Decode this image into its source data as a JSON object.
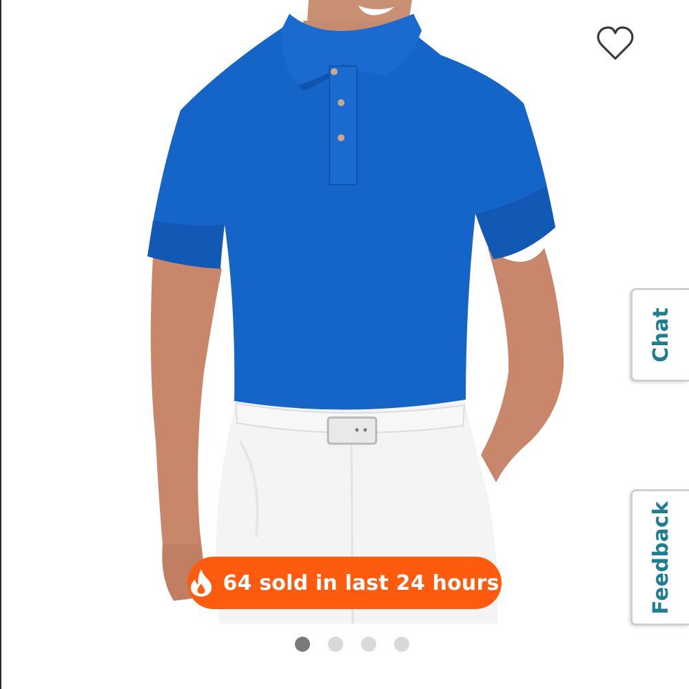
{
  "product": {
    "image_icon": "polo-shirt-model-photo",
    "shirt_color": "#1565c8",
    "pants_color": "#f4f4f4"
  },
  "favorite": {
    "icon": "heart-outline-icon"
  },
  "side_tabs": {
    "chat": "Chat",
    "feedback": "Feedback"
  },
  "badge": {
    "icon": "flame-icon",
    "text": "64 sold in last 24 hours",
    "color": "#ff5b0f"
  },
  "carousel": {
    "total": 4,
    "active_index": 0
  }
}
